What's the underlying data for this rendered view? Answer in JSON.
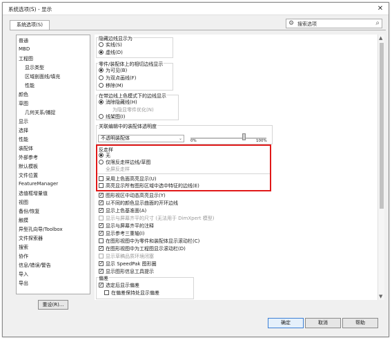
{
  "window": {
    "title": "系统选项(S) - 显示",
    "close": "✕"
  },
  "tab": {
    "label": "系统选项(S)"
  },
  "search": {
    "placeholder": "搜索选项"
  },
  "tree": [
    "普通",
    "MBD",
    "工程图",
    "显示类型",
    "区域剖面线/填充",
    "性能",
    "颜色",
    "草图",
    "几何关系/捕捉",
    "显示",
    "选择",
    "性能",
    "装配体",
    "外部参考",
    "默认模板",
    "文件位置",
    "FeatureManager",
    "选值框增量值",
    "视图",
    "备份/恢复",
    "触摸",
    "异型孔向导/Toolbox",
    "文件探索器",
    "搜索",
    "协作",
    "信息/错误/警告",
    "导入",
    "导出"
  ],
  "reset_button": "重设(R)...",
  "panel": {
    "hidden_edges_title": "隐藏边线显示为",
    "he_solid": "实线(S)",
    "he_dashed": "虚线(D)",
    "tangent_title": "零件/装配体上的相切边线显示",
    "tg_visible": "为可见(B)",
    "tg_phantom": "为双点画线(F)",
    "tg_remove": "移除(M)",
    "shaded_title": "在带边线上色模式下的边线显示",
    "sh_hlr": "消除隐藏线(H)",
    "sh_note": "为隐显零件优化(N)",
    "sh_wire": "线架图(I)",
    "transparency_title": "关联编辑中的装配体透明度",
    "transparency_value": "不透明装配体",
    "pct_min": "0%",
    "pct_max": "100%",
    "aa_title": "反走样",
    "aa_none": "无",
    "aa_lines": "仅限反走样边线/草图",
    "aa_full": "全屏反走样",
    "cb_color_highlight": "采用上色面高亮显示(U)",
    "cb_highlight_all": "高亮显示所有图形区域中选中特征的边线(E)",
    "cb_dynamic": "图形视区中动态高亮显示(Y)",
    "cb_open_edges": "以不同的颜色显示曲面的开环边线",
    "cb_shaded_plane": "显示上色基准面(A)",
    "cb_dimxpert": "显示与屏幕齐平的尺寸 (无法用于 DimXpert 模型)",
    "cb_flat_notes": "显示与屏幕齐平的注释",
    "cb_ref_triad": "显示参考三重轴(I)",
    "cb_scroll_part": "在图形视图中为零件和装配体显示滚动栏(C)",
    "cb_scroll_drawing": "在图形视图中为工程图显示滚动栏(D)",
    "cb_draft": "显示草稿品质环境闭塞",
    "cb_speedpak": "显示 SpeedPak 图形圈",
    "cb_tooltips": "显示图形信息工具提示",
    "deviation_title": "偏差",
    "cb_dev_prompt": "选定后显示偏差",
    "cb_dev_all": "在偏差保持处显示偏差"
  },
  "buttons": {
    "ok": "确定",
    "cancel": "取消",
    "help": "帮助"
  }
}
